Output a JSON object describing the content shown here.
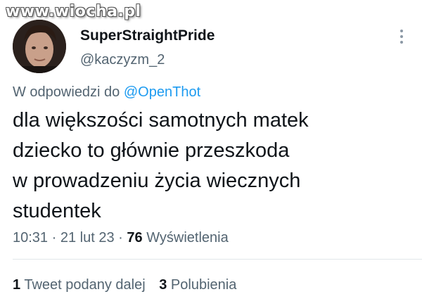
{
  "watermark": "www.wiocha.pl",
  "author": {
    "display_name": "SuperStraightPride",
    "handle": "@kaczyzm_2"
  },
  "reply": {
    "prefix": "W odpowiedzi do",
    "mention": "@OpenThot"
  },
  "tweet": {
    "lines": [
      "dla większości samotnych matek",
      "dziecko to głównie przeszkoda",
      "w prowadzeniu życia wiecznych",
      "studentek"
    ]
  },
  "meta": {
    "time": "10:31",
    "separator": "·",
    "date": "21 lut 23",
    "views_count": "76",
    "views_label": "Wyświetlenia"
  },
  "stats": {
    "retweets_count": "1",
    "retweets_label": "Tweet podany dalej",
    "likes_count": "3",
    "likes_label": "Polubienia"
  },
  "colors": {
    "link": "#1d9bf0",
    "secondary_text": "#536471",
    "primary_text": "#0f1419"
  },
  "icons": {
    "more": "more-vertical-icon"
  }
}
